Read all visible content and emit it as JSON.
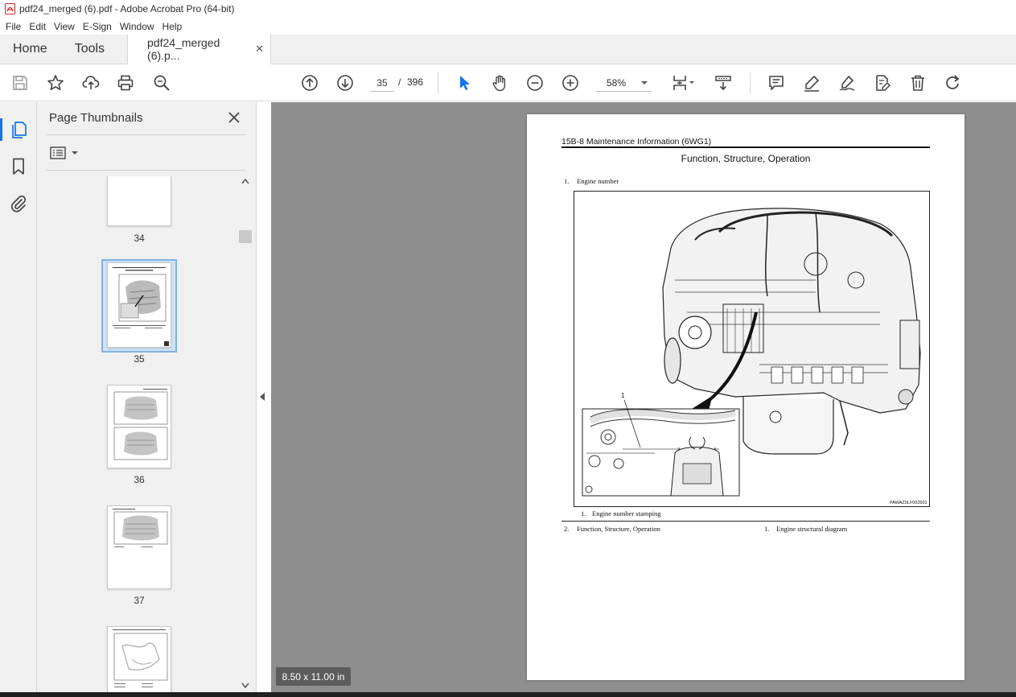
{
  "window": {
    "title": "pdf24_merged (6).pdf - Adobe Acrobat Pro (64-bit)"
  },
  "menu": [
    "File",
    "Edit",
    "View",
    "E-Sign",
    "Window",
    "Help"
  ],
  "tabs": {
    "home": "Home",
    "tools": "Tools",
    "document": "pdf24_merged (6).p...",
    "close_glyph": "✕"
  },
  "toolbar": {
    "current_page": "35",
    "page_separator": "/",
    "total_pages": "396",
    "zoom": "58%",
    "icons": [
      "save-icon",
      "bookmark-star-icon",
      "upload-icon",
      "print-icon",
      "zoom-search-icon",
      "prev-page-icon",
      "next-page-icon",
      "select-pointer-icon",
      "hand-icon",
      "zoom-out-icon",
      "zoom-in-icon",
      "page-fit-icon",
      "scroll-mode-icon",
      "comment-icon",
      "highlight-icon",
      "sign-icon",
      "fill-sign-icon",
      "delete-icon",
      "rotate-icon"
    ]
  },
  "thumbnails_panel": {
    "title": "Page Thumbnails",
    "pages": [
      {
        "label": "34"
      },
      {
        "label": "35",
        "selected": true
      },
      {
        "label": "36"
      },
      {
        "label": "37"
      },
      {
        "label": ""
      }
    ]
  },
  "document_page": {
    "header": "15B-8   Maintenance Information (6WG1)",
    "section_title": "Function, Structure, Operation",
    "item1_num": "1.",
    "item1_text": "Engine number",
    "callout_number": "1",
    "figure_code": "PAWAZ0LF002501",
    "caption_num": "1.",
    "caption_text": "Engine number stamping",
    "item2_num": "2.",
    "item2_text": "Function, Structure, Operation",
    "item2_sub_num": "1.",
    "item2_sub_text": "Engine structural diagram"
  },
  "status": {
    "page_size": "8.50 x 11.00 in"
  },
  "colors": {
    "accent": "#1473e6",
    "pdf_red": "#d7261e",
    "doc_background": "#8e8e8e"
  }
}
